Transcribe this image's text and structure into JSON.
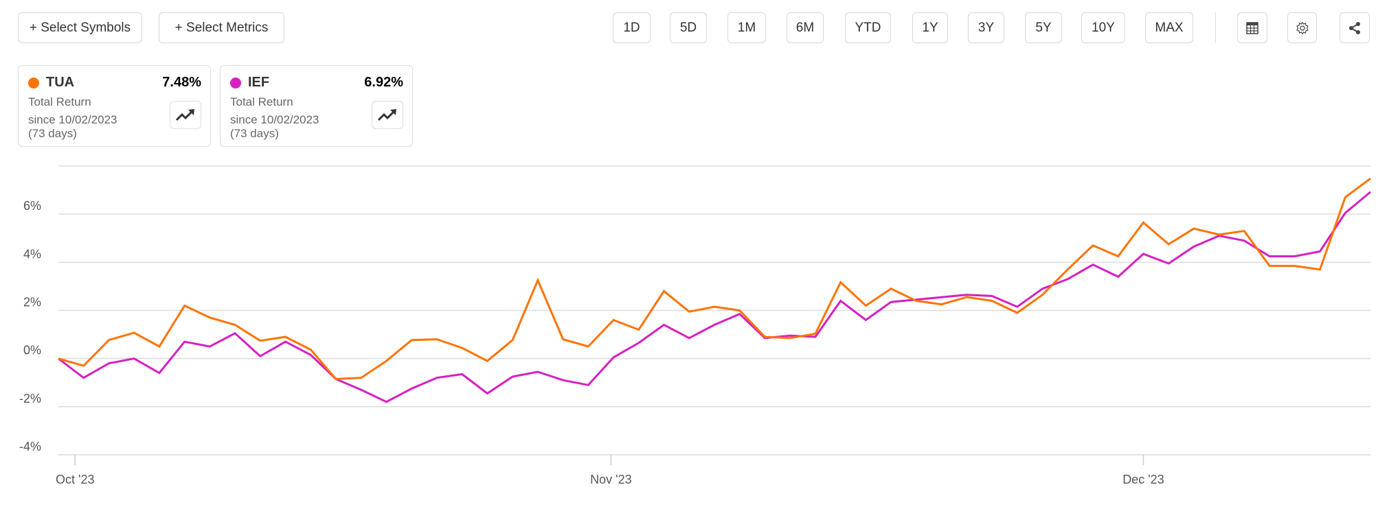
{
  "toolbar": {
    "select_symbols": "+ Select Symbols",
    "select_metrics": "+ Select Metrics",
    "periods": [
      "1D",
      "5D",
      "1M",
      "6M",
      "YTD",
      "1Y",
      "3Y",
      "5Y",
      "10Y",
      "MAX"
    ],
    "icons": [
      "table-icon",
      "gear-icon",
      "share-icon"
    ]
  },
  "cards": [
    {
      "ticker": "TUA",
      "value": "7.48%",
      "metric": "Total Return",
      "since": "since 10/02/2023",
      "days": "(73 days)",
      "color": "#ff7300"
    },
    {
      "ticker": "IEF",
      "value": "6.92%",
      "metric": "Total Return",
      "since": "since 10/02/2023",
      "days": "(73 days)",
      "color": "#d61fc1"
    }
  ],
  "chart_data": {
    "type": "line",
    "title": "",
    "xlabel": "",
    "ylabel": "",
    "ylim": [
      -4,
      8
    ],
    "yticks": [
      -4,
      -2,
      0,
      2,
      4,
      6,
      8
    ],
    "ytick_labels": [
      "-4%",
      "-2%",
      "0%",
      "2%",
      "4%",
      "6%",
      ""
    ],
    "xtick_labels": [
      "Oct '23",
      "Nov '23",
      "Dec '23"
    ],
    "xtick_index": [
      0.66,
      21.9,
      43
    ],
    "grid": true,
    "series": [
      {
        "name": "TUA",
        "color": "#ff7300",
        "values": [
          0,
          -0.3,
          0.77,
          1.07,
          0.5,
          2.2,
          1.7,
          1.4,
          0.74,
          0.9,
          0.37,
          -0.85,
          -0.8,
          -0.1,
          0.77,
          0.8,
          0.44,
          -0.1,
          0.77,
          3.25,
          0.8,
          0.5,
          1.6,
          1.2,
          2.8,
          1.95,
          2.15,
          2.0,
          0.9,
          0.85,
          1.03,
          3.17,
          2.2,
          2.9,
          2.4,
          2.25,
          2.55,
          2.4,
          1.9,
          2.65,
          3.7,
          4.7,
          4.25,
          5.65,
          4.75,
          5.4,
          5.15,
          5.3,
          3.85,
          3.85,
          3.7,
          6.7,
          7.48
        ]
      },
      {
        "name": "IEF",
        "color": "#d61fc1",
        "values": [
          0,
          -0.8,
          -0.2,
          0,
          -0.6,
          0.7,
          0.5,
          1.05,
          0.1,
          0.7,
          0.15,
          -0.85,
          -1.3,
          -1.8,
          -1.25,
          -0.8,
          -0.65,
          -1.45,
          -0.75,
          -0.55,
          -0.9,
          -1.1,
          0.05,
          0.65,
          1.4,
          0.85,
          1.4,
          1.85,
          0.85,
          0.95,
          0.9,
          2.4,
          1.6,
          2.35,
          2.45,
          2.55,
          2.65,
          2.6,
          2.15,
          2.9,
          3.3,
          3.9,
          3.4,
          4.35,
          3.95,
          4.65,
          5.1,
          4.9,
          4.25,
          4.25,
          4.45,
          6.05,
          6.92
        ]
      }
    ]
  }
}
